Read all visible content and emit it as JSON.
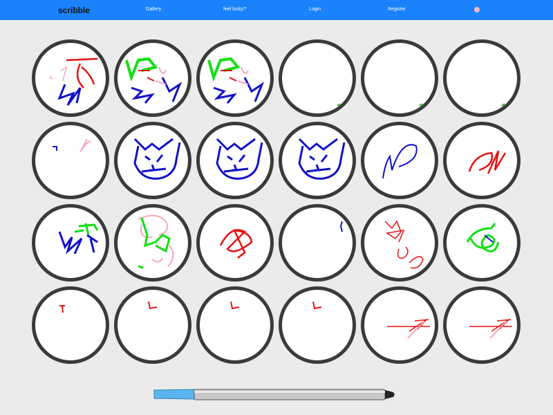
{
  "navbar": {
    "brand": "scribble",
    "links": [
      "Gallery",
      "feel lucky?",
      "Login",
      "Register"
    ],
    "accent_color": "#1a82fb",
    "user_dot_color": "#f5b8c7"
  },
  "gallery": {
    "rows": 4,
    "cols": 6,
    "scribbles": [
      "mixed-red-blue-pink",
      "mixed-green-red-blue-pink",
      "mixed-green-red-blue-pink",
      "green-dot",
      "green-dot",
      "green-dot",
      "blue-pink-marks",
      "blue-cat-face",
      "blue-cat-face",
      "blue-cat-face",
      "blue-loop",
      "red-loop",
      "blue-green-zigzag",
      "green-pink-scribble",
      "red-scribble",
      "blue-tick",
      "red-curls",
      "green-blob",
      "red-t",
      "red-l",
      "red-l",
      "red-l",
      "red-pink-lines",
      "red-pink-lines"
    ]
  },
  "pen": {
    "cap_color": "#5ab4ee",
    "body_color": "#c8c8c8",
    "tip_color": "#222222"
  }
}
